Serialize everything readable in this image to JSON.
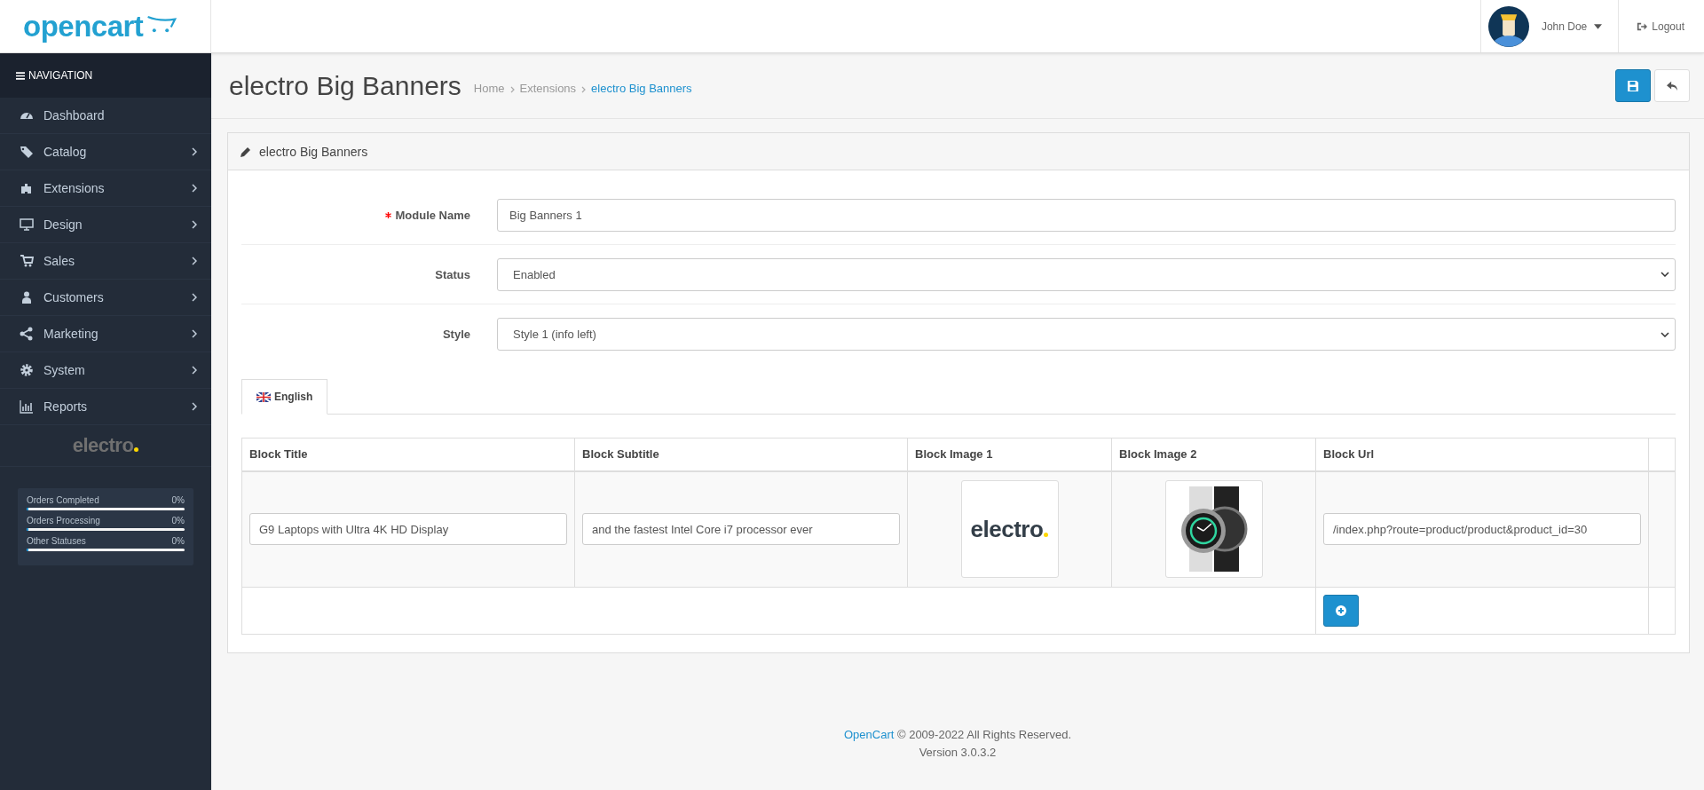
{
  "header": {
    "logo": "opencart",
    "user": {
      "name": "John Doe"
    },
    "logout": "Logout"
  },
  "sidebar": {
    "title": "NAVIGATION",
    "items": [
      {
        "label": "Dashboard",
        "expandable": false
      },
      {
        "label": "Catalog",
        "expandable": true
      },
      {
        "label": "Extensions",
        "expandable": true
      },
      {
        "label": "Design",
        "expandable": true
      },
      {
        "label": "Sales",
        "expandable": true
      },
      {
        "label": "Customers",
        "expandable": true
      },
      {
        "label": "Marketing",
        "expandable": true
      },
      {
        "label": "System",
        "expandable": true
      },
      {
        "label": "Reports",
        "expandable": true
      }
    ],
    "brand": "electro",
    "stats": [
      {
        "label": "Orders Completed",
        "value": "0%",
        "level": 0
      },
      {
        "label": "Orders Processing",
        "value": "0%",
        "level": 0
      },
      {
        "label": "Other Statuses",
        "value": "0%",
        "level": 0
      }
    ]
  },
  "page": {
    "title": "electro Big Banners",
    "breadcrumb": [
      {
        "label": "Home",
        "selected": false
      },
      {
        "label": "Extensions",
        "selected": false
      },
      {
        "label": "electro Big Banners",
        "selected": true
      }
    ]
  },
  "panel": {
    "title": "electro Big Banners",
    "fields": [
      {
        "kind": "text",
        "label": "Module Name",
        "required": true,
        "value": "Big Banners 1"
      },
      {
        "kind": "select",
        "label": "Status",
        "required": false,
        "value": "Enabled"
      },
      {
        "kind": "select",
        "label": "Style",
        "required": false,
        "value": "Style 1 (info left)"
      }
    ],
    "tabs": [
      {
        "label": "English",
        "selected": true
      }
    ],
    "table": {
      "columns": [
        "Block Title",
        "Block Subtitle",
        "Block Image 1",
        "Block Image 2",
        "Block Url"
      ],
      "rows": [
        {
          "title": "G9 Laptops with Ultra 4K HD Display",
          "subtitle": "and the fastest Intel Core i7 processor ever",
          "image_1": {
            "kind": "logo",
            "text": "electro"
          },
          "image_2": {
            "kind": "photo"
          },
          "url": "/index.php?route=product/product&product_id=30"
        }
      ]
    }
  },
  "footer": {
    "link": "OpenCart",
    "text": "© 2009-2022 All Rights Reserved.",
    "version": "Version 3.0.3.2"
  }
}
